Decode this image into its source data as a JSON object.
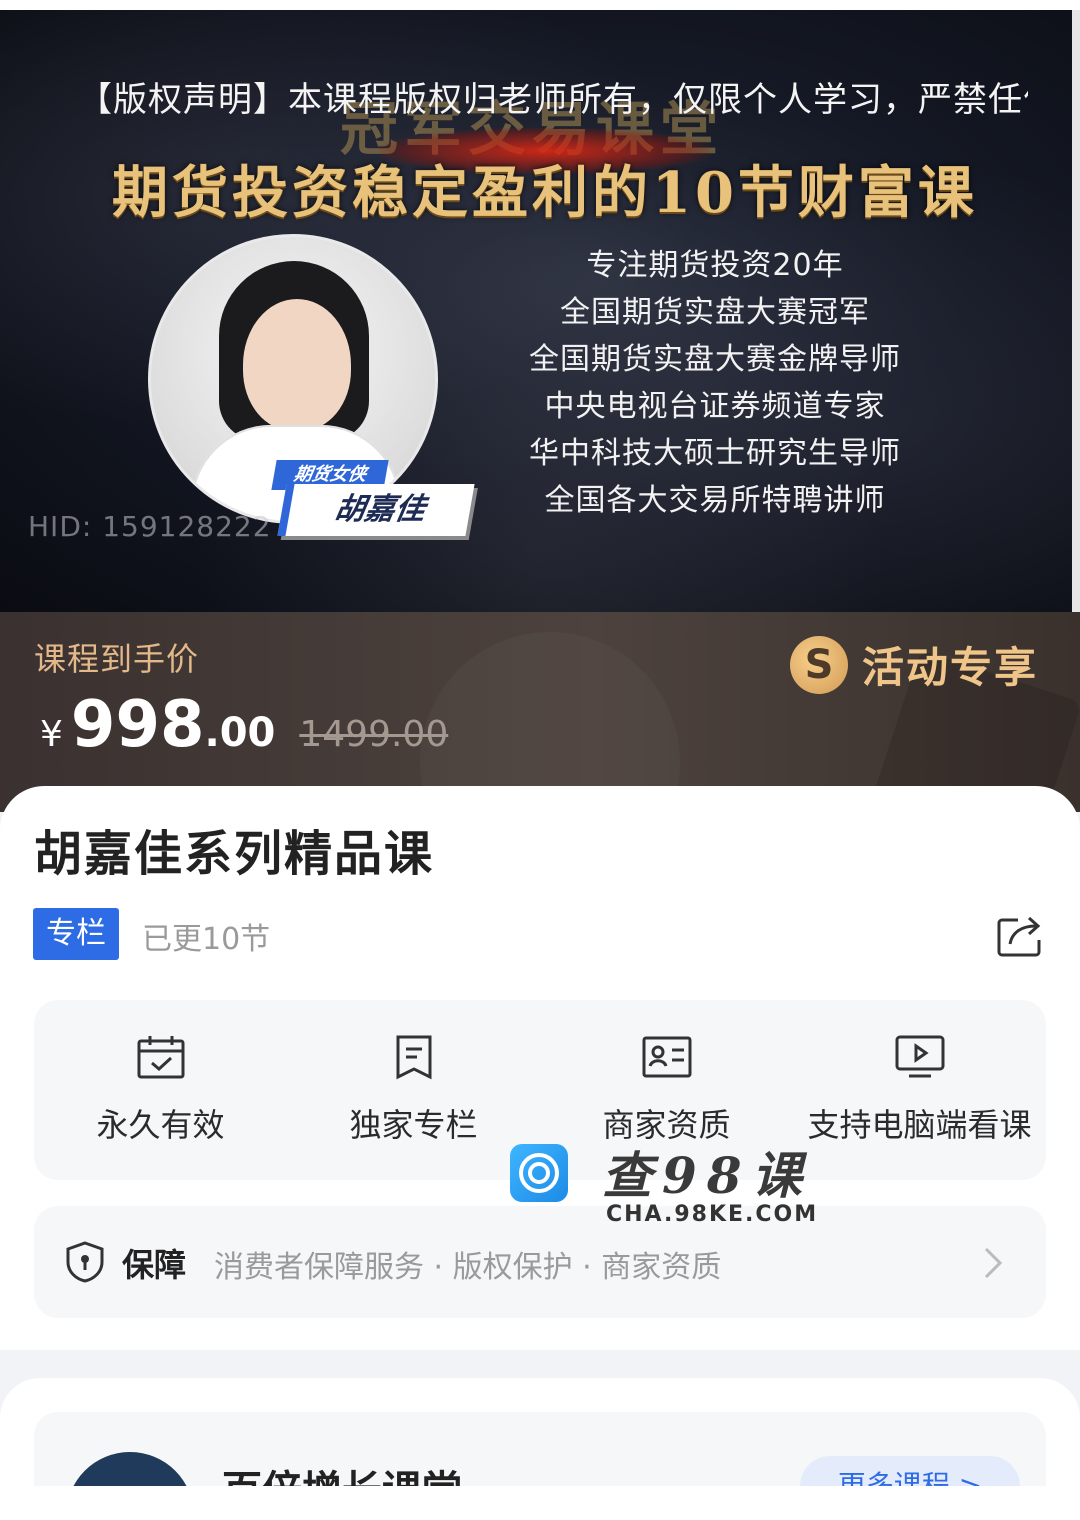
{
  "banner": {
    "copyright": "【版权声明】本课程版权归老师所有，仅限个人学习，严禁任何刑",
    "bg_title": "冠军交易课堂",
    "main_title": "期货投资稳定盈利的10节财富课",
    "teacher_tag": "期货女侠",
    "teacher_name": "胡嘉佳",
    "hid": "HID: 159128222",
    "credentials": [
      "专注期货投资20年",
      "全国期货实盘大赛冠军",
      "全国期货实盘大赛金牌导师",
      "中央电视台证券频道专家",
      "华中科技大硕士研究生导师",
      "全国各大交易所特聘讲师"
    ]
  },
  "price": {
    "label": "课程到手价",
    "currency": "¥",
    "integer": "998",
    "decimal": ".00",
    "original": "1499.00",
    "promo_text": "活动专享"
  },
  "course": {
    "title": "胡嘉佳系列精品课",
    "tag": "专栏",
    "updated": "已更10节"
  },
  "features": [
    {
      "label": "永久有效",
      "icon": "calendar-check-icon"
    },
    {
      "label": "独家专栏",
      "icon": "bookmark-doc-icon"
    },
    {
      "label": "商家资质",
      "icon": "id-card-icon"
    },
    {
      "label": "支持电脑端看课",
      "icon": "monitor-play-icon"
    }
  ],
  "guarantee": {
    "title": "保障",
    "items": "消费者保障服务 · 版权保护 · 商家资质"
  },
  "watermark": {
    "text": "查98课",
    "sub": "CHA.98KE.COM"
  },
  "shop": {
    "name": "百倍增长课堂",
    "more": "更多课程 >"
  },
  "colors": {
    "accent": "#2e6ce6",
    "price_label": "#e3b98a",
    "promo": "#f0c58a"
  }
}
